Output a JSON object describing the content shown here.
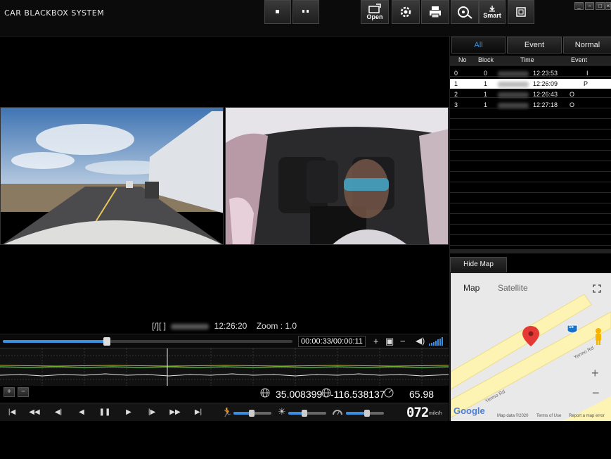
{
  "app": {
    "title": "CAR BLACKBOX SYSTEM"
  },
  "toolbar": {
    "open_label": "Open",
    "smart_label": "Smart",
    "icons": [
      "stop-icon",
      "pause-icon",
      "open-icon",
      "settings-icon",
      "print-icon",
      "film-icon",
      "smart-icon",
      "fullscreen-icon"
    ]
  },
  "window_controls": [
    "minimize-icon",
    "restore-icon",
    "maximize-icon",
    "close-icon"
  ],
  "video": {
    "status_prefix": "[/][ ]",
    "status_time": "12:26:20",
    "zoom_text": "Zoom : 1.0"
  },
  "seek": {
    "time_display": "00:00:33/00:00:11",
    "progress": 0.36
  },
  "gps": {
    "latitude": "35.008399",
    "longitude": "-116.538137",
    "speed_value": "65.98"
  },
  "speedometer": {
    "value": "072",
    "unit": "mile/h"
  },
  "sliders": {
    "brightness": 0.42,
    "contrast": 0.55,
    "volume": 0.48
  },
  "tabs": {
    "all": "All",
    "event": "Event",
    "normal": "Normal"
  },
  "list": {
    "headers": {
      "no": "No",
      "block": "Block",
      "time": "Time",
      "event": "Event"
    },
    "rows": [
      {
        "no": "0",
        "block": "0",
        "time": "12:23:53",
        "event": "I"
      },
      {
        "no": "1",
        "block": "1",
        "time": "12:26:09",
        "event": "P"
      },
      {
        "no": "2",
        "block": "1",
        "time": "12:26:43",
        "event": "O"
      },
      {
        "no": "3",
        "block": "1",
        "time": "12:27:18",
        "event": "O"
      }
    ]
  },
  "map": {
    "hide_map_label": "Hide Map",
    "tab_map": "Map",
    "tab_satellite": "Satellite",
    "road_label_1": "Yermo Rd",
    "road_label_2": "Yermo Rd",
    "shield_number": "15",
    "logo_text": "Google",
    "footer_data": "Map data ©2020",
    "footer_terms": "Terms of Use",
    "footer_report": "Report a map error"
  },
  "colors": {
    "accent": "#3a8fe0",
    "graph_green": "#3fbf2a",
    "graph_white": "#e8e8e8",
    "map_road": "#fdf3b2",
    "pin": "#e53935"
  }
}
